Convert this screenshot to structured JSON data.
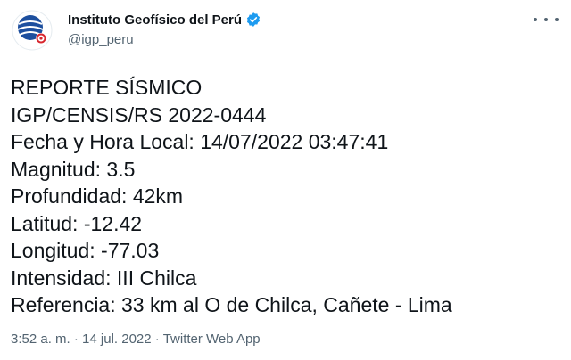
{
  "author": {
    "display_name": "Instituto Geofísico del Perú",
    "handle": "@igp_peru",
    "verified": true
  },
  "icons": {
    "avatar": "igp-logo-avatar",
    "verified": "verified-badge-icon",
    "more": "more-options-icon"
  },
  "colors": {
    "verified_blue": "#1d9bf0",
    "text": "#0f1419",
    "secondary": "#536471",
    "avatar_blue": "#1d4f9e",
    "avatar_red": "#d8262e"
  },
  "tweet": {
    "lines": [
      "REPORTE SÍSMICO",
      "IGP/CENSIS/RS 2022-0444",
      "Fecha y Hora Local: 14/07/2022 03:47:41",
      "Magnitud: 3.5",
      "Profundidad: 42km",
      "Latitud: -12.42",
      "Longitud: -77.03",
      "Intensidad: III Chilca",
      "Referencia: 33 km al O de Chilca, Cañete - Lima"
    ]
  },
  "meta": {
    "time": "3:52 a. m.",
    "separator": "·",
    "date": "14 jul. 2022",
    "source": "Twitter Web App"
  }
}
